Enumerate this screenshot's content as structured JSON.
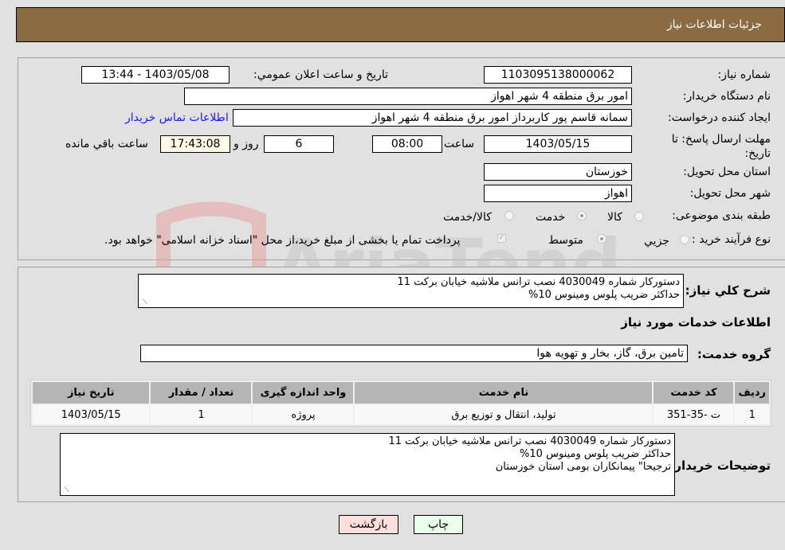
{
  "header": {
    "title": "جزئیات اطلاعات نیاز"
  },
  "fields": {
    "need_number": {
      "label": "شماره نیاز:",
      "value": "1103095138000062"
    },
    "announce_datetime": {
      "label": "تاریخ و ساعت اعلان عمومي:",
      "value": "1403/05/08 - 13:44"
    },
    "buyer_org": {
      "label": "نام دستگاه خریدار:",
      "value": "امور برق منطقه 4 شهر اهواز"
    },
    "requester": {
      "label": "ایجاد کننده درخواست:",
      "value": "سمانه قاسم پور کاربرداز امور برق منطقه 4 شهر اهواز"
    },
    "buyer_contact_link": "اطلاعات تماس خریدار",
    "deadline": {
      "label": "مهلت ارسال پاسخ: تا تاریخ:",
      "date": "1403/05/15",
      "time_label": "ساعت",
      "time": "08:00",
      "days": "6",
      "days_label": "روز و",
      "remaining": "17:43:08",
      "remaining_label": "ساعت باقي مانده"
    },
    "province": {
      "label": "استان محل تحویل:",
      "value": "خوزستان"
    },
    "city": {
      "label": "شهر محل تحویل:",
      "value": "اهواز"
    },
    "category": {
      "label": "طبقه بندی موضوعی:",
      "options": [
        {
          "label": "کالا",
          "checked": false
        },
        {
          "label": "خدمت",
          "checked": true
        },
        {
          "label": "کالا/خدمت",
          "checked": false
        }
      ]
    },
    "purchase_type": {
      "label": "نوع فرآیند خرید :",
      "options": [
        {
          "label": "جزيي",
          "checked": false
        },
        {
          "label": "متوسط",
          "checked": true
        }
      ],
      "treasury_note": "پرداخت تمام یا بخشی از مبلغ خرید،از محل \"اسناد خزانه اسلامی\" خواهد بود.",
      "treasury_checked": true
    }
  },
  "description": {
    "label": "شرح کلي نياز:",
    "value": "دستورکار شماره 4030049 نصب ترانس ملاشیه خیابان برکت 11\nحداکثر ضریب پلوس ومینوس 10%"
  },
  "services_section_title": "اطلاعات خدمات مورد نیاز",
  "service_group": {
    "label": "گروه خدمت:",
    "value": "تامین برق، گاز، بخار و تهویه هوا"
  },
  "table": {
    "headers": [
      "ردیف",
      "کد خدمت",
      "نام خدمت",
      "واحد اندازه گیری",
      "تعداد / مقدار",
      "تاریخ نیاز"
    ],
    "rows": [
      [
        "1",
        "ت -35-351",
        "تولید، انتقال و توزیع برق",
        "پروژه",
        "1",
        "1403/05/15"
      ]
    ]
  },
  "buyer_notes": {
    "label": "توضیحات خریدار:",
    "value": "دستورکار شماره 4030049 نصب ترانس ملاشیه خیابان برکت 11\nحداکثر ضریب پلوس ومینوس 10%\nترجیحا\" پیمانکاران بومی استان خوزستان"
  },
  "buttons": {
    "print": "چاپ",
    "back": "بازگشت"
  },
  "colors": {
    "header_bg": "#8b6b42",
    "print_bg": "#eaffea",
    "back_bg": "#ffdede",
    "link": "#1a1aff"
  }
}
